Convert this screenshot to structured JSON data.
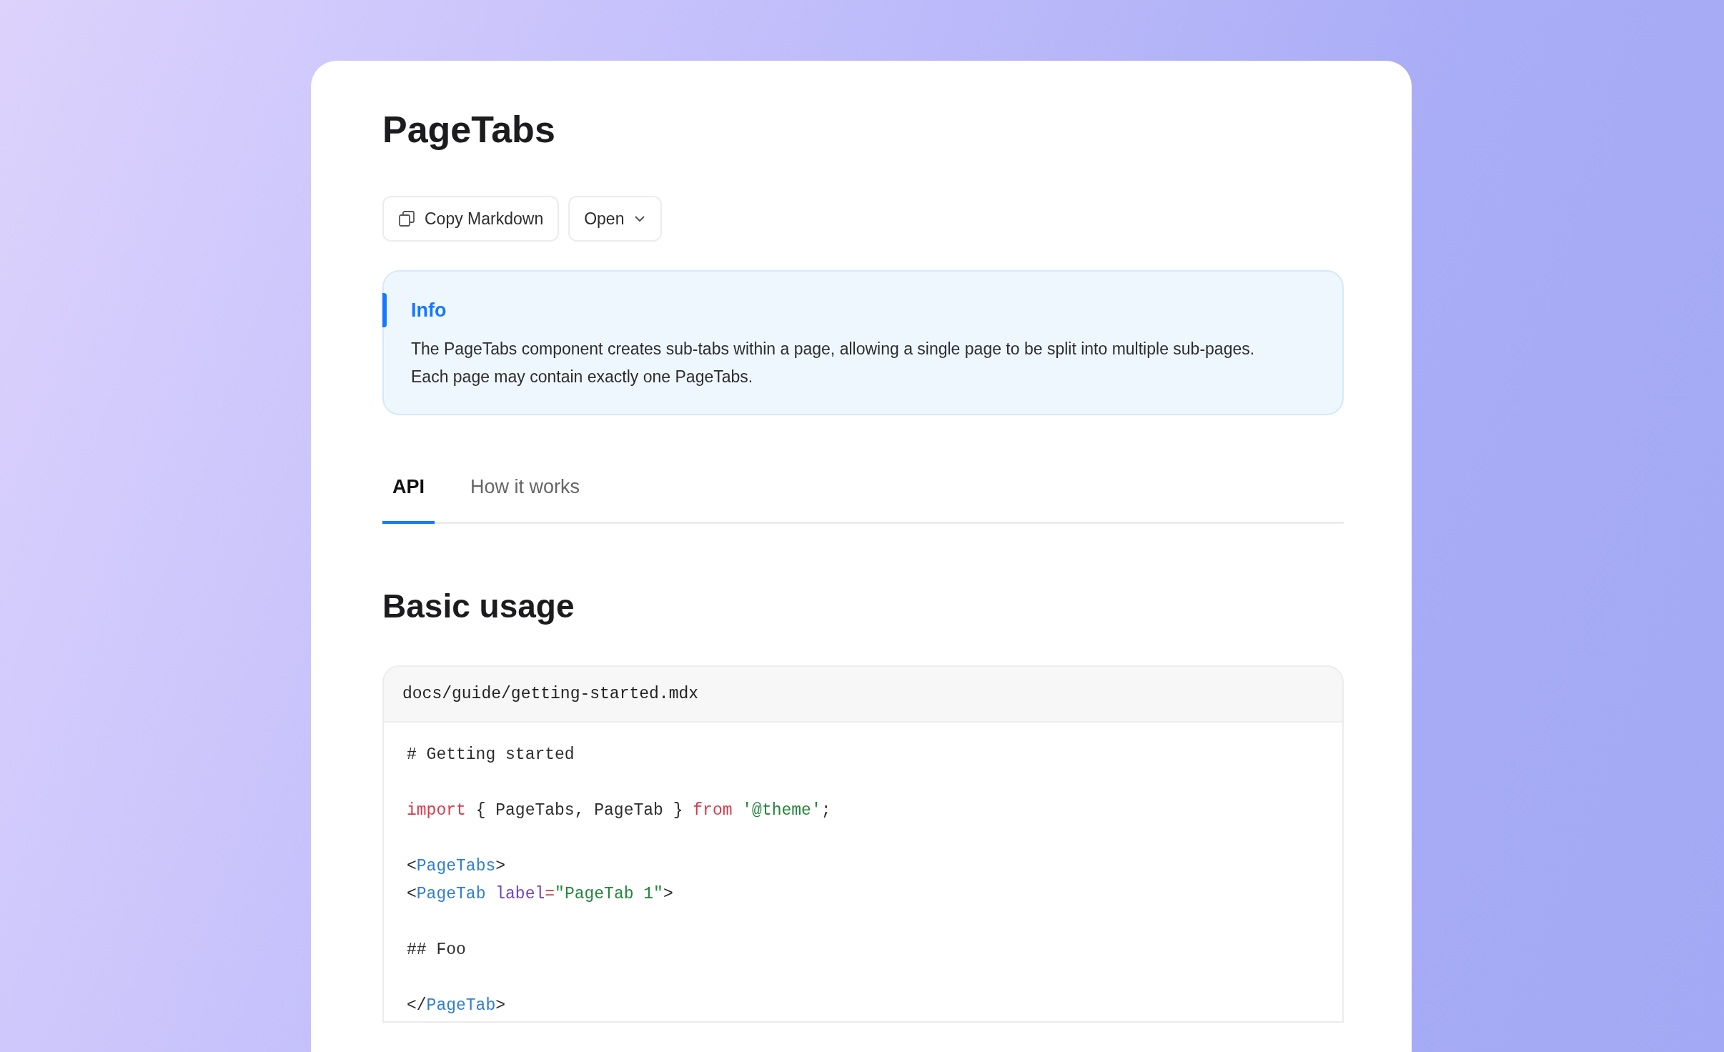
{
  "title": "PageTabs",
  "buttons": [
    {
      "label": "Copy Markdown",
      "kind": "copy"
    },
    {
      "label": "Open",
      "kind": "dropdown"
    }
  ],
  "callout": {
    "title": "Info",
    "text": "The PageTabs component creates sub-tabs within a page, allowing a single page to be split into multiple sub-pages. Each page may contain exactly one PageTabs."
  },
  "tabs": [
    {
      "label": "API",
      "selected": true
    },
    {
      "label": "How it works",
      "selected": false
    }
  ],
  "heading": "Basic usage",
  "code": {
    "filename": "docs/guide/getting-started.mdx",
    "lines": [
      {
        "kind": "code",
        "tokens": [
          {
            "kind": "plain",
            "text": "# Getting started"
          }
        ]
      },
      {
        "kind": "blank"
      },
      {
        "kind": "code",
        "tokens": [
          {
            "kind": "keyword",
            "text": "import"
          },
          {
            "kind": "plain",
            "text": " { PageTabs, PageTab } "
          },
          {
            "kind": "keyword",
            "text": "from"
          },
          {
            "kind": "string",
            "text": " '@theme'"
          },
          {
            "kind": "plain",
            "text": ";"
          }
        ]
      },
      {
        "kind": "blank"
      },
      {
        "kind": "code",
        "tokens": [
          {
            "kind": "plain",
            "text": "<"
          },
          {
            "kind": "tag",
            "text": "PageTabs"
          },
          {
            "kind": "plain",
            "text": ">"
          }
        ]
      },
      {
        "kind": "code",
        "tokens": [
          {
            "kind": "plain",
            "text": "<"
          },
          {
            "kind": "tag",
            "text": "PageTab"
          },
          {
            "kind": "attr",
            "text": " label"
          },
          {
            "kind": "keyword",
            "text": "="
          },
          {
            "kind": "string",
            "text": "\"PageTab 1\""
          },
          {
            "kind": "plain",
            "text": ">"
          }
        ]
      },
      {
        "kind": "blank"
      },
      {
        "kind": "code",
        "tokens": [
          {
            "kind": "plain",
            "text": "## Foo"
          }
        ]
      },
      {
        "kind": "blank"
      },
      {
        "kind": "code",
        "tokens": [
          {
            "kind": "plain",
            "text": "</"
          },
          {
            "kind": "tag",
            "text": "PageTab"
          },
          {
            "kind": "plain",
            "text": ">"
          }
        ]
      }
    ]
  }
}
